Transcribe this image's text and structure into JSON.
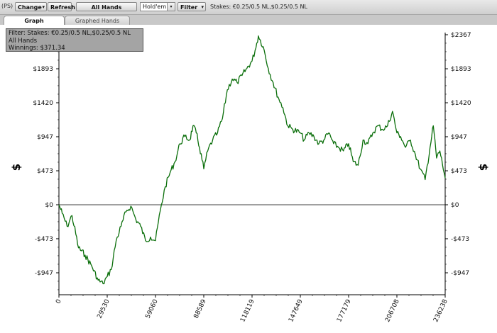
{
  "toolbar": {
    "ps_label": "(PS)",
    "change_label": "Change",
    "refresh_label": "Refresh",
    "all_hands_label": "All Hands",
    "game_select_value": "Hold'em",
    "filter_label": "Filter",
    "stakes_text": "Stakes: €0.25/0.5 NL,$0.25/0.5 NL"
  },
  "tabs": [
    {
      "label": "Graph",
      "active": true
    },
    {
      "label": "Graphed Hands",
      "active": false
    }
  ],
  "info_box": {
    "filter_line": "Filter: Stakes: €0.25/0.5 NL,$0.25/0.5 NL",
    "hands_line": "All Hands",
    "winnings_line": "Winnings: $371.34"
  },
  "colors": {
    "line": "#0a6e0a",
    "toolbar_bg": "#dcdcdc",
    "info_box_bg": "#a4a4a4"
  },
  "chart_data": {
    "type": "line",
    "title": "",
    "ylabel": "$",
    "xlabel": "",
    "y_ticks": [
      2367,
      1893,
      1420,
      947,
      473,
      0,
      -473,
      -947
    ],
    "y_tick_labels": [
      "$2367",
      "$1893",
      "$1420",
      "$947",
      "$473",
      "$0",
      "-$473",
      "-$947"
    ],
    "x_ticks": [
      0,
      29530,
      59060,
      88589,
      118119,
      147649,
      177179,
      206708,
      236238
    ],
    "x_tick_labels": [
      "0",
      "29530",
      "59060",
      "88589",
      "118119",
      "147649",
      "177179",
      "206708",
      "236238"
    ],
    "xlim": [
      0,
      236238
    ],
    "ylim": [
      -1200,
      2367
    ],
    "grid": false,
    "series": [
      {
        "x": [
          0,
          2000,
          5000,
          8000,
          12000,
          16000,
          20000,
          24000,
          27000,
          29530,
          32000,
          35000,
          38000,
          41000,
          44000,
          47000,
          50000,
          53000,
          56000,
          59060,
          62000,
          65000,
          68000,
          71000,
          74000,
          77000,
          80000,
          82000,
          84000,
          86000,
          88589,
          91000,
          94000,
          97000,
          100000,
          103000,
          106000,
          109000,
          112000,
          115000,
          118119,
          120000,
          122000,
          125000,
          128000,
          131000,
          134000,
          137000,
          140000,
          143000,
          147649,
          150000,
          153000,
          156000,
          159000,
          162000,
          165000,
          168000,
          171000,
          174000,
          177179,
          180000,
          183000,
          186000,
          189000,
          192000,
          195000,
          198000,
          201000,
          204000,
          206708,
          209000,
          212000,
          215000,
          218000,
          221000,
          224000,
          227000,
          229000,
          231000,
          233000,
          236238
        ],
        "y": [
          0,
          -120,
          -300,
          -150,
          -600,
          -700,
          -850,
          -1050,
          -1100,
          -1000,
          -900,
          -500,
          -300,
          -100,
          -20,
          -200,
          -300,
          -500,
          -450,
          -500,
          -80,
          250,
          450,
          600,
          850,
          950,
          900,
          1100,
          1000,
          800,
          500,
          750,
          900,
          1000,
          1200,
          1600,
          1750,
          1700,
          1800,
          1900,
          2000,
          2150,
          2350,
          2200,
          1900,
          1700,
          1500,
          1350,
          1100,
          1050,
          1000,
          900,
          1000,
          950,
          850,
          900,
          1000,
          850,
          800,
          750,
          850,
          600,
          550,
          900,
          850,
          1000,
          1100,
          1050,
          1100,
          1300,
          1000,
          950,
          800,
          900,
          700,
          500,
          350,
          800,
          1100,
          650,
          750,
          371.34
        ]
      }
    ]
  }
}
